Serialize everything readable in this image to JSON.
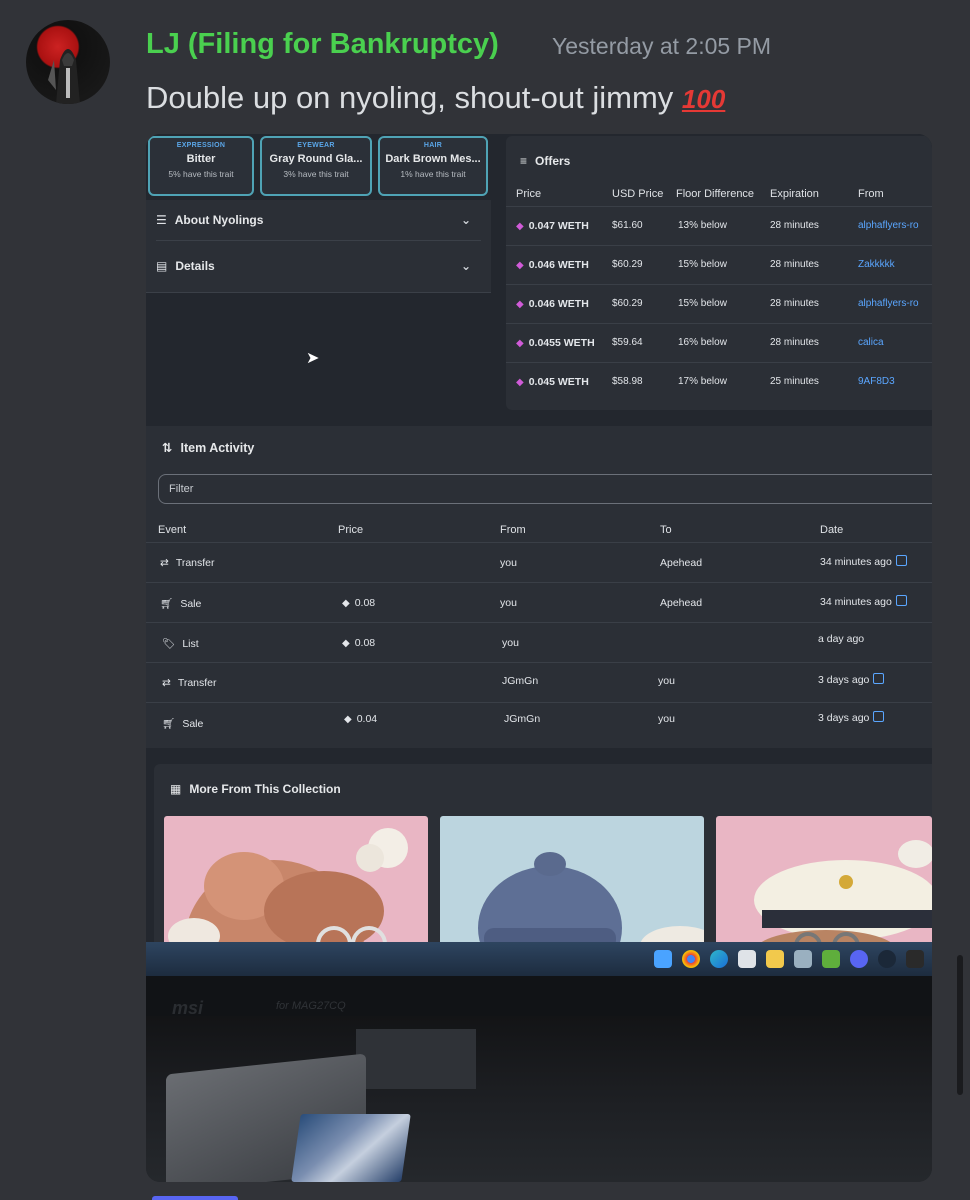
{
  "message": {
    "username": "LJ (Filing for Bankruptcy)",
    "timestamp": "Yesterday at 2:05 PM",
    "content": "Double up on nyoling, shout-out jimmy",
    "emoji": "100"
  },
  "screen": {
    "traits": [
      {
        "category": "EXPRESSION",
        "value": "Bitter",
        "pct": "5% have this trait"
      },
      {
        "category": "EYEWEAR",
        "value": "Gray Round Gla...",
        "pct": "3% have this trait"
      },
      {
        "category": "HAIR",
        "value": "Dark Brown Mes...",
        "pct": "1% have this trait"
      }
    ],
    "accordion": {
      "about": "About Nyolings",
      "details": "Details"
    },
    "offers": {
      "title": "Offers",
      "headers": {
        "price": "Price",
        "usd": "USD Price",
        "floor": "Floor Difference",
        "expiration": "Expiration",
        "from": "From"
      },
      "rows": [
        {
          "price": "0.047 WETH",
          "usd": "$61.60",
          "floor": "13% below",
          "expiration": "28 minutes",
          "from": "alphaflyers-ro"
        },
        {
          "price": "0.046 WETH",
          "usd": "$60.29",
          "floor": "15% below",
          "expiration": "28 minutes",
          "from": "Zakkkkk"
        },
        {
          "price": "0.046 WETH",
          "usd": "$60.29",
          "floor": "15% below",
          "expiration": "28 minutes",
          "from": "alphaflyers-ro"
        },
        {
          "price": "0.0455 WETH",
          "usd": "$59.64",
          "floor": "16% below",
          "expiration": "28 minutes",
          "from": "calica"
        },
        {
          "price": "0.045 WETH",
          "usd": "$58.98",
          "floor": "17% below",
          "expiration": "25 minutes",
          "from": "9AF8D3"
        }
      ]
    },
    "activity": {
      "title": "Item Activity",
      "filter_placeholder": "Filter",
      "headers": {
        "event": "Event",
        "price": "Price",
        "from": "From",
        "to": "To",
        "date": "Date"
      },
      "rows": [
        {
          "event": "Transfer",
          "price": "",
          "from": "you",
          "to": "Apehead",
          "date": "34 minutes ago"
        },
        {
          "event": "Sale",
          "price": "0.08",
          "from": "you",
          "to": "Apehead",
          "date": "34 minutes ago"
        },
        {
          "event": "List",
          "price": "0.08",
          "from": "you",
          "to": "",
          "date": "a day ago"
        },
        {
          "event": "Transfer",
          "price": "",
          "from": "JGmGn",
          "to": "you",
          "date": "3 days ago"
        },
        {
          "event": "Sale",
          "price": "0.04",
          "from": "JGmGn",
          "to": "you",
          "date": "3 days ago"
        }
      ]
    },
    "more": {
      "title": "More From This Collection"
    },
    "monitor_label": "for MAG27CQ"
  },
  "colors": {
    "username": "#4ad04f",
    "link": "#5aa6ff",
    "eth": "#d05bd8",
    "background": "#313338"
  }
}
